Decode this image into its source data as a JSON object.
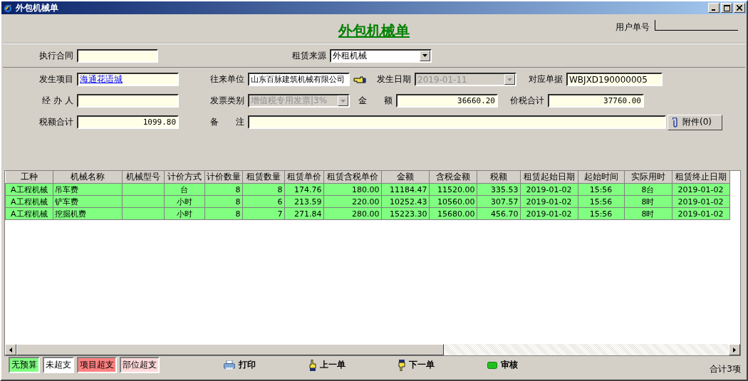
{
  "window": {
    "title": "外包机械单"
  },
  "header": {
    "title": "外包机械单",
    "user_no_label": "用户单号"
  },
  "contract_row": [
    {
      "label": "执行合同",
      "kind": "text"
    },
    {
      "label": "租赁来源",
      "kind": "dropdown",
      "value": "外租机械",
      "disabled": false
    }
  ],
  "form_rows": [
    [
      {
        "label": "发生项目",
        "kind": "link",
        "value": "海通花语城"
      },
      {
        "label": "往来单位",
        "kind": "pick",
        "value": "山东百脉建筑机械有限公司"
      },
      {
        "label": "发生日期",
        "kind": "dropdown",
        "value": "2019-01-11",
        "disabled": true
      },
      {
        "label": "对应单据",
        "kind": "text",
        "value": "WBJXD190000005"
      }
    ],
    [
      {
        "label": "经 办 人",
        "kind": "text"
      },
      {
        "label": "发票类别",
        "kind": "dropdown",
        "value": "增值税专用发票|3%",
        "disabled": true
      },
      {
        "label": "金　　额",
        "kind": "number",
        "value": "36660.20"
      },
      {
        "label": "价税合计",
        "kind": "number",
        "value": "37760.00"
      }
    ],
    [
      {
        "label": "税额合计",
        "kind": "number",
        "value": "1099.80"
      },
      {
        "label": "备　　注",
        "kind": "memo"
      }
    ]
  ],
  "attachment_button": "附件(0)",
  "table": {
    "columns": [
      "工种",
      "机械名称",
      "机械型号",
      "计价方式",
      "计价数量",
      "租赁数量",
      "租赁单价",
      "租赁含税单价",
      "金额",
      "含税金额",
      "税额",
      "租赁起始日期",
      "起始时间",
      "实际用时",
      "租赁终止日期"
    ],
    "rows": [
      {
        "color": "#80ff80",
        "cells": [
          "A工程机械",
          "吊车费",
          "",
          "台",
          "8",
          "8",
          "174.76",
          "180.00",
          "11184.47",
          "11520.00",
          "335.53",
          "2019-01-02",
          "15:56",
          "8台",
          "2019-01-02"
        ]
      },
      {
        "color": "#80ff80",
        "cells": [
          "A工程机械",
          "铲车费",
          "",
          "小时",
          "8",
          "6",
          "213.59",
          "220.00",
          "10252.43",
          "10560.00",
          "307.57",
          "2019-01-02",
          "15:56",
          "8时",
          "2019-01-02"
        ]
      },
      {
        "color": "#80ff80",
        "cells": [
          "A工程机械",
          "挖掘机费",
          "",
          "小时",
          "8",
          "7",
          "271.84",
          "280.00",
          "15223.30",
          "15680.00",
          "456.70",
          "2019-01-02",
          "15:56",
          "8时",
          "2019-01-02"
        ]
      }
    ]
  },
  "legend": [
    {
      "label": "无预算",
      "color": "#80ff80"
    },
    {
      "label": "未超支",
      "color": "#ffffff"
    },
    {
      "label": "项目超支",
      "color": "#ff8080"
    },
    {
      "label": "部位超支",
      "color": "#ffd8d8"
    }
  ],
  "buttons": [
    {
      "label": "打印",
      "kind": "print"
    },
    {
      "label": "上一单",
      "kind": "prev"
    },
    {
      "label": "下一单",
      "kind": "next"
    },
    {
      "label": "审核",
      "kind": "approve"
    }
  ],
  "total": "合计3项"
}
